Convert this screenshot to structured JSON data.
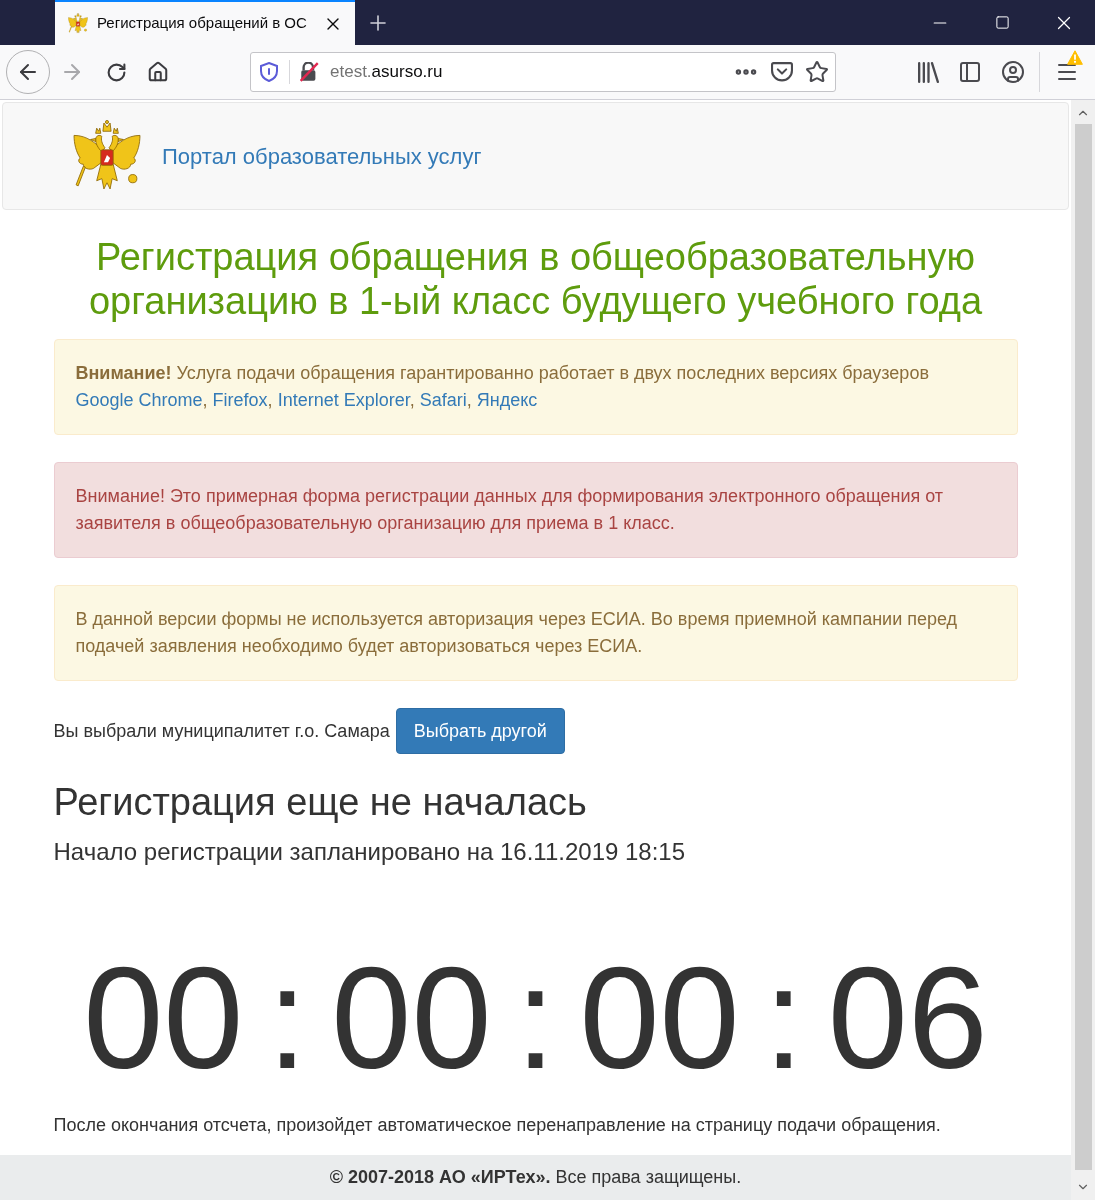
{
  "browser": {
    "tab": {
      "title": "Регистрация обращений в ОС",
      "selected": true
    },
    "forward_disabled": true,
    "address": {
      "prefix": "etest.",
      "domain": "asurso.ru"
    },
    "menu_warning": true
  },
  "header": {
    "brand": "Портал образовательных услуг"
  },
  "title": "Регистрация обращения в общеобразовательную организацию в 1-ый класс будущего учебного года",
  "alerts": [
    {
      "kind": "warning",
      "text": "**Внимание!** Услуга подачи обращения гарантированно работает в двух последних версиях браузеров",
      "links": [
        "Google Chrome",
        "Firefox",
        "Internet Explorer",
        "Safari",
        "Яндекс"
      ],
      "link_separator": ", "
    },
    {
      "kind": "danger",
      "text": "Внимание! Это примерная форма регистрации данных для формирования электронного обращения от заявителя в общеобразовательную организацию для приема в 1 класс."
    },
    {
      "kind": "warning",
      "text": "В данной версии формы не используется авторизация через ЕСИА. Во время приемной кампании перед подачей заявления необходимо будет авторизоваться через ЕСИА."
    }
  ],
  "municipality": {
    "text": "Вы выбрали муниципалитет г.о. Самара",
    "button": "Выбрать другой"
  },
  "status": {
    "heading": "Регистрация еще не началась",
    "subheading": "Начало регистрации запланировано на 16.11.2019 18:15"
  },
  "countdown": {
    "digits": [
      "00",
      "00",
      "00",
      "06"
    ],
    "separators": [
      ":",
      ":",
      ":"
    ]
  },
  "redirect_note": "После окончания отсчета, произойдет автоматическое перенаправление на страницу подачи обращения.",
  "footer": "**© 2007-2018 АО «ИРТех».** Все права защищены."
}
